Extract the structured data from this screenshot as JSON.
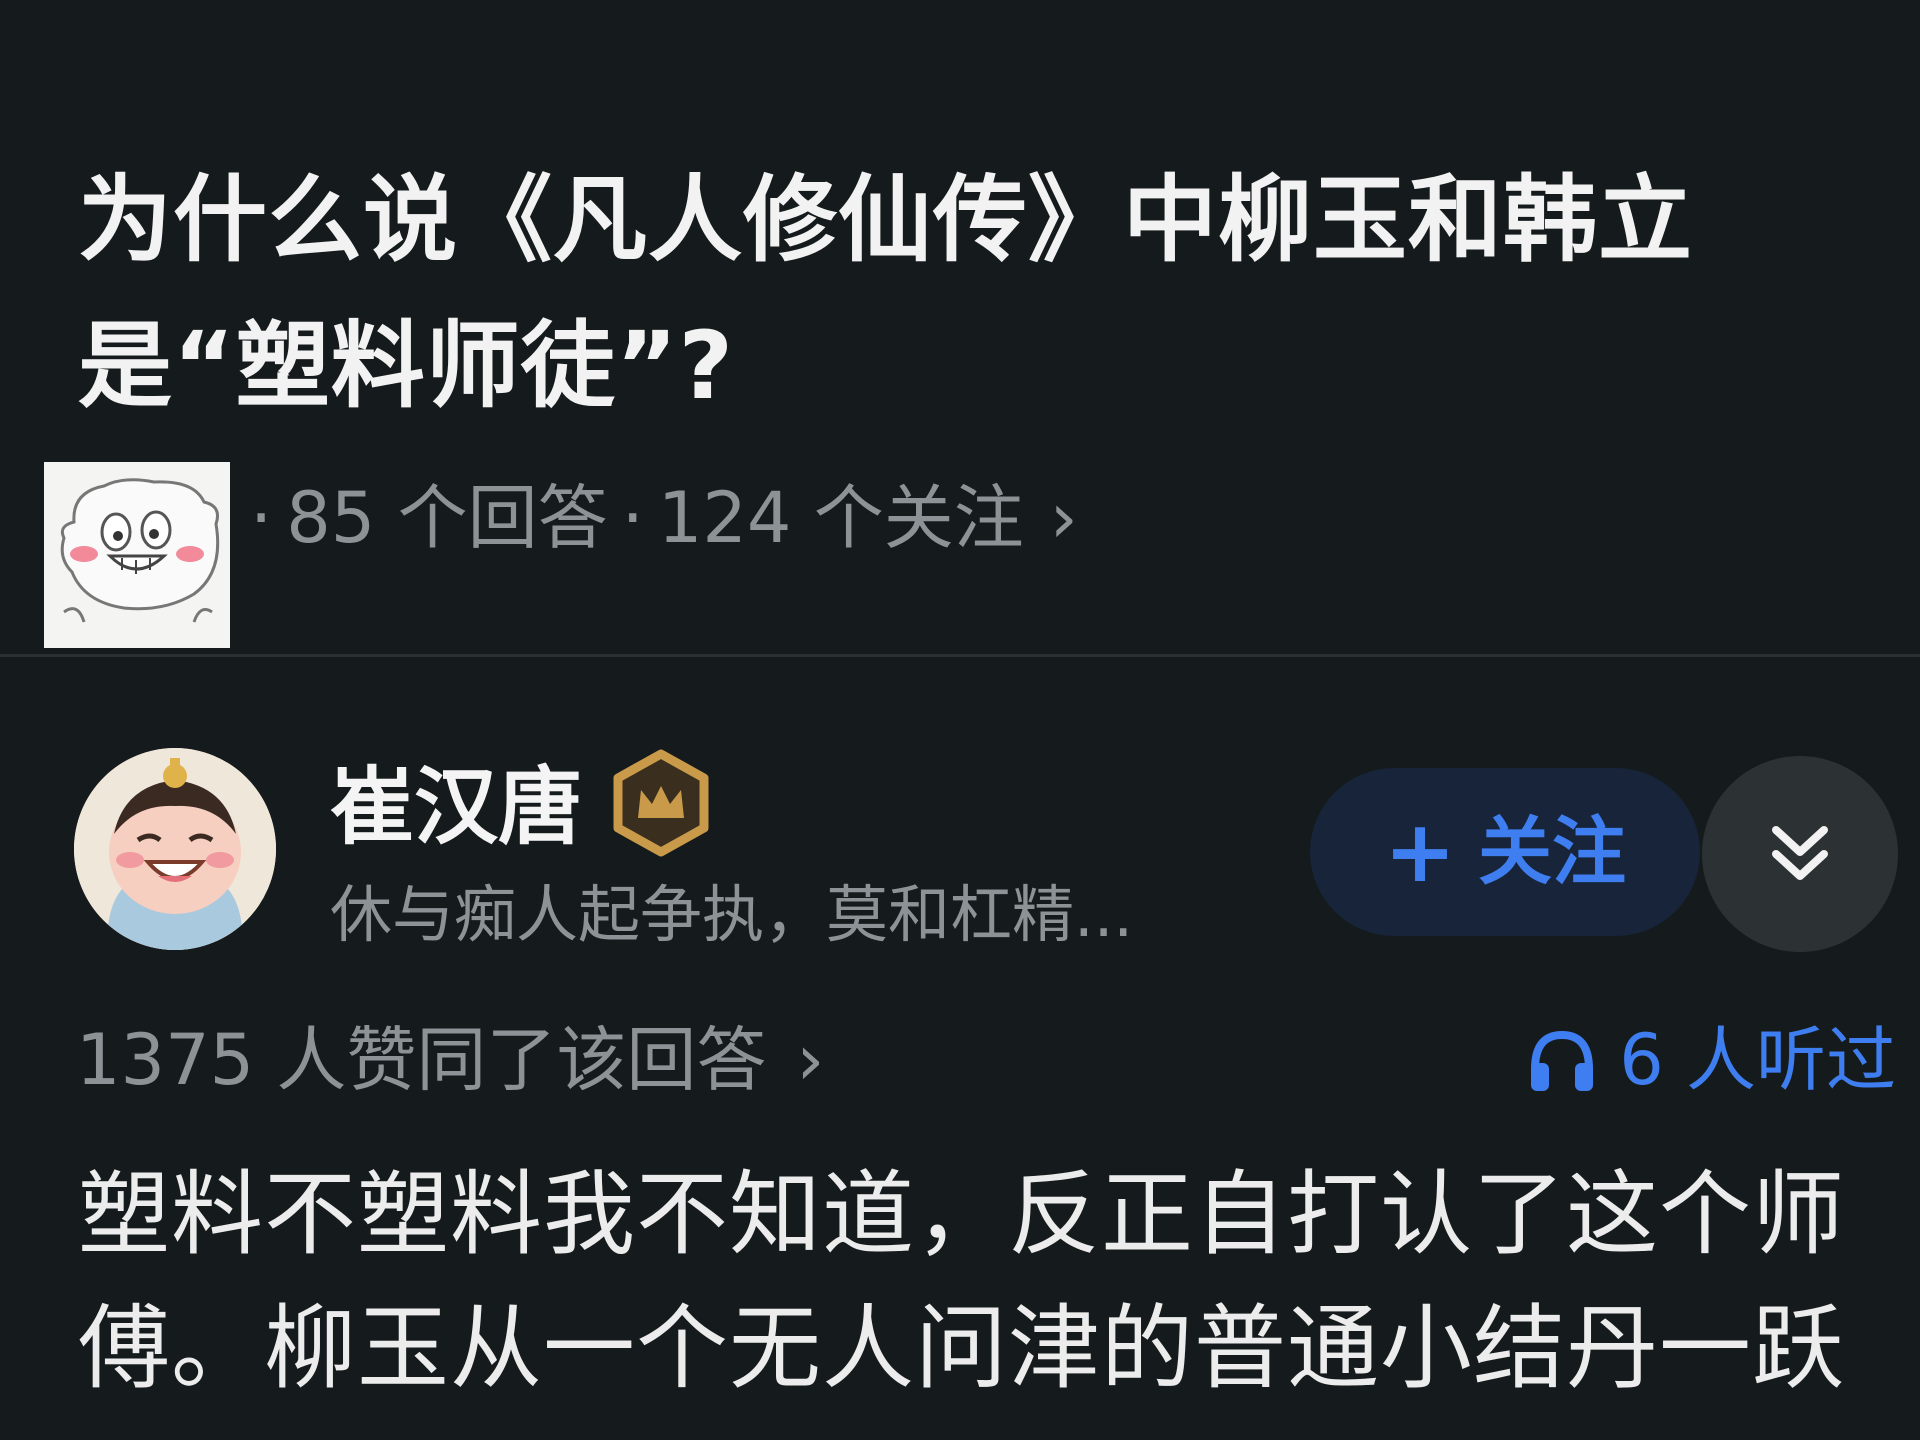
{
  "question": {
    "title": "为什么说《凡人修仙传》中柳玉和韩立是“塑料师徒”?",
    "answers_text": "85 个回答",
    "follows_text": "124 个关注",
    "separator": "·",
    "chevron": "›",
    "asker_avatar_icon": "cartoon-avatar-icon"
  },
  "answer": {
    "author_name": "崔汉唐",
    "badge_icon": "crown-badge-icon",
    "author_bio": "休与痴人起争执，莫和杠精...",
    "follow_plus": "+",
    "follow_label": "关注",
    "expand_icon": "double-chevron-down-icon",
    "votes_text": "1375 人赞同了该回答",
    "votes_chevron": "›",
    "listen_icon": "headphones-icon",
    "listened_text": "6 人听过",
    "content": "塑料不塑料我不知道，反正自打认了这个师傅。柳玉从一个无人问津的普通小结丹一跃"
  },
  "colors": {
    "background": "#151b1c",
    "accent": "#3f7ef0",
    "follow_button_bg": "#17243a",
    "muted_text": "#8c9296",
    "badge_gold": "#c99a4a"
  }
}
